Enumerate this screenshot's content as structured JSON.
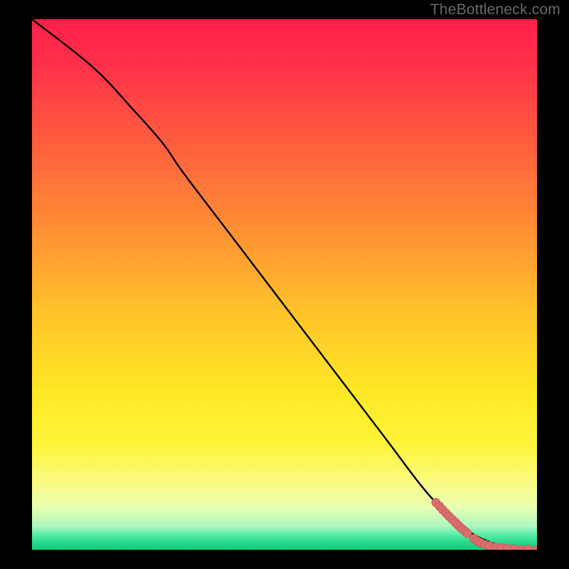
{
  "watermark": "TheBottleneck.com",
  "colors": {
    "frame": "#000000",
    "line": "#000000",
    "dot_fill": "#db6e6e",
    "dot_stroke": "#c35a5a",
    "gradient_stops": [
      {
        "offset": 0.0,
        "color": "#ff1f4a"
      },
      {
        "offset": 0.08,
        "color": "#ff2f4a"
      },
      {
        "offset": 0.22,
        "color": "#ff5a3f"
      },
      {
        "offset": 0.38,
        "color": "#ff8a35"
      },
      {
        "offset": 0.55,
        "color": "#ffc22a"
      },
      {
        "offset": 0.7,
        "color": "#ffe825"
      },
      {
        "offset": 0.8,
        "color": "#fff43a"
      },
      {
        "offset": 0.87,
        "color": "#fbfb80"
      },
      {
        "offset": 0.92,
        "color": "#e8ffb0"
      },
      {
        "offset": 0.955,
        "color": "#aef7c0"
      },
      {
        "offset": 0.975,
        "color": "#4be8a0"
      },
      {
        "offset": 0.99,
        "color": "#1ed688"
      },
      {
        "offset": 1.0,
        "color": "#18c97e"
      }
    ]
  },
  "chart_data": {
    "type": "line",
    "title": "",
    "xlabel": "",
    "ylabel": "",
    "xlim": [
      0,
      100
    ],
    "ylim": [
      0,
      100
    ],
    "grid": false,
    "legend": false,
    "series": [
      {
        "name": "curve",
        "kind": "line",
        "x": [
          0,
          12,
          20,
          26,
          30,
          40,
          50,
          60,
          70,
          78,
          84,
          88,
          92,
          95,
          100
        ],
        "y": [
          100,
          91,
          83,
          76.5,
          71,
          58.5,
          46,
          33.5,
          21,
          11,
          5.3,
          2.6,
          1.0,
          0.3,
          0
        ]
      },
      {
        "name": "points-upper-cluster",
        "kind": "scatter",
        "r": 6,
        "x": [
          80.0,
          80.7,
          81.3,
          82.0,
          82.6,
          83.2,
          83.8,
          84.3,
          84.8,
          85.3,
          85.8,
          86.2
        ],
        "y": [
          8.9,
          8.2,
          7.55,
          6.9,
          6.3,
          5.75,
          5.2,
          4.7,
          4.25,
          3.85,
          3.45,
          3.1
        ]
      },
      {
        "name": "points-lower-tail",
        "kind": "scatter",
        "r": 6,
        "x": [
          87.5,
          88.1,
          88.8,
          89.7,
          90.6,
          91.8,
          93.0,
          94.2,
          95.5,
          97.0,
          98.3,
          100.0
        ],
        "y": [
          2.1,
          1.7,
          1.35,
          1.0,
          0.75,
          0.5,
          0.35,
          0.25,
          0.17,
          0.1,
          0.06,
          0.03
        ]
      }
    ]
  }
}
